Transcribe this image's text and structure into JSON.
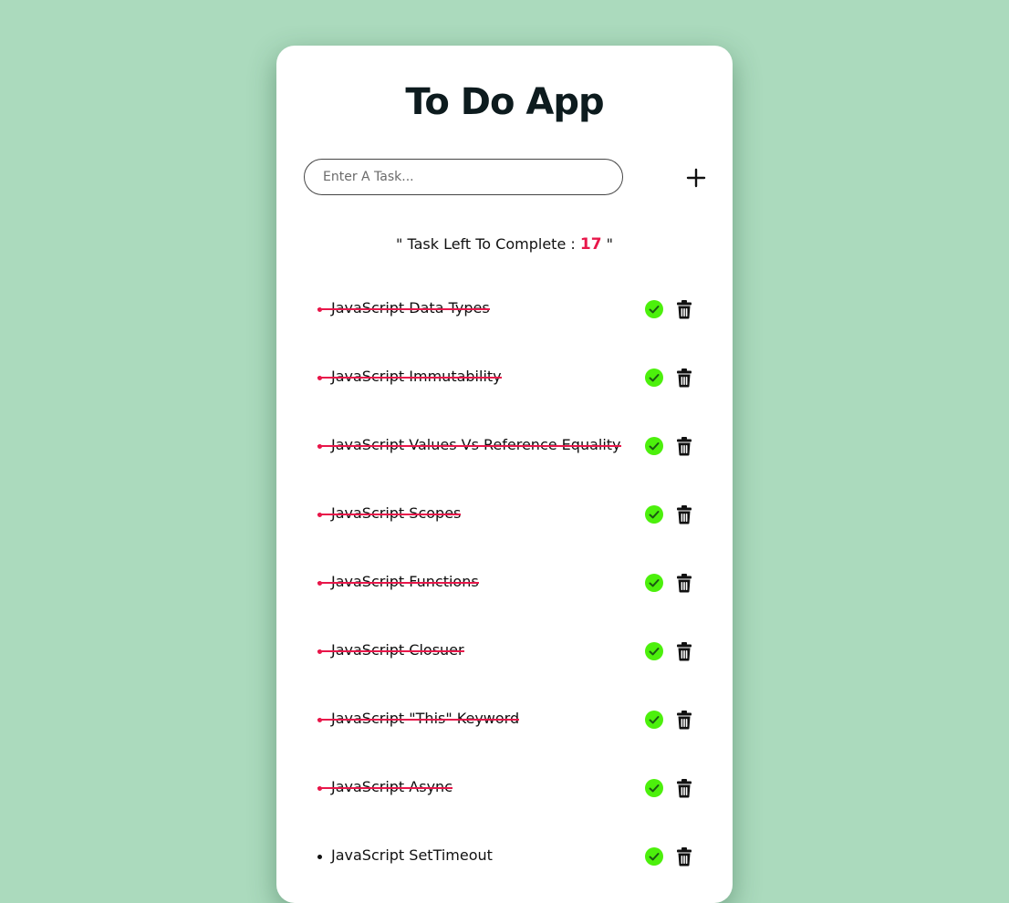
{
  "app": {
    "title": "To Do App"
  },
  "input": {
    "placeholder": "Enter A Task...",
    "value": ""
  },
  "counter": {
    "prefix": "\" Task Left To Complete : ",
    "count": "17",
    "suffix": " \""
  },
  "icons": {
    "add": "plus-icon",
    "complete": "check-circle-icon",
    "delete": "trash-icon"
  },
  "colors": {
    "background": "#abdabd",
    "accent": "#e8174a",
    "check": "#4cf00c"
  },
  "tasks": [
    {
      "text": "JavaScript Data Types",
      "completed": true
    },
    {
      "text": "JavaScript Immutability",
      "completed": true
    },
    {
      "text": "JavaScript Values Vs Reference Equality",
      "completed": true
    },
    {
      "text": "JavaScript Scopes",
      "completed": true
    },
    {
      "text": "JavaScript Functions",
      "completed": true
    },
    {
      "text": "JavaScript Closuer",
      "completed": true
    },
    {
      "text": "JavaScript \"This\" Keyword",
      "completed": true
    },
    {
      "text": "JavaScript Async",
      "completed": true
    },
    {
      "text": "JavaScript SetTimeout",
      "completed": false
    }
  ]
}
